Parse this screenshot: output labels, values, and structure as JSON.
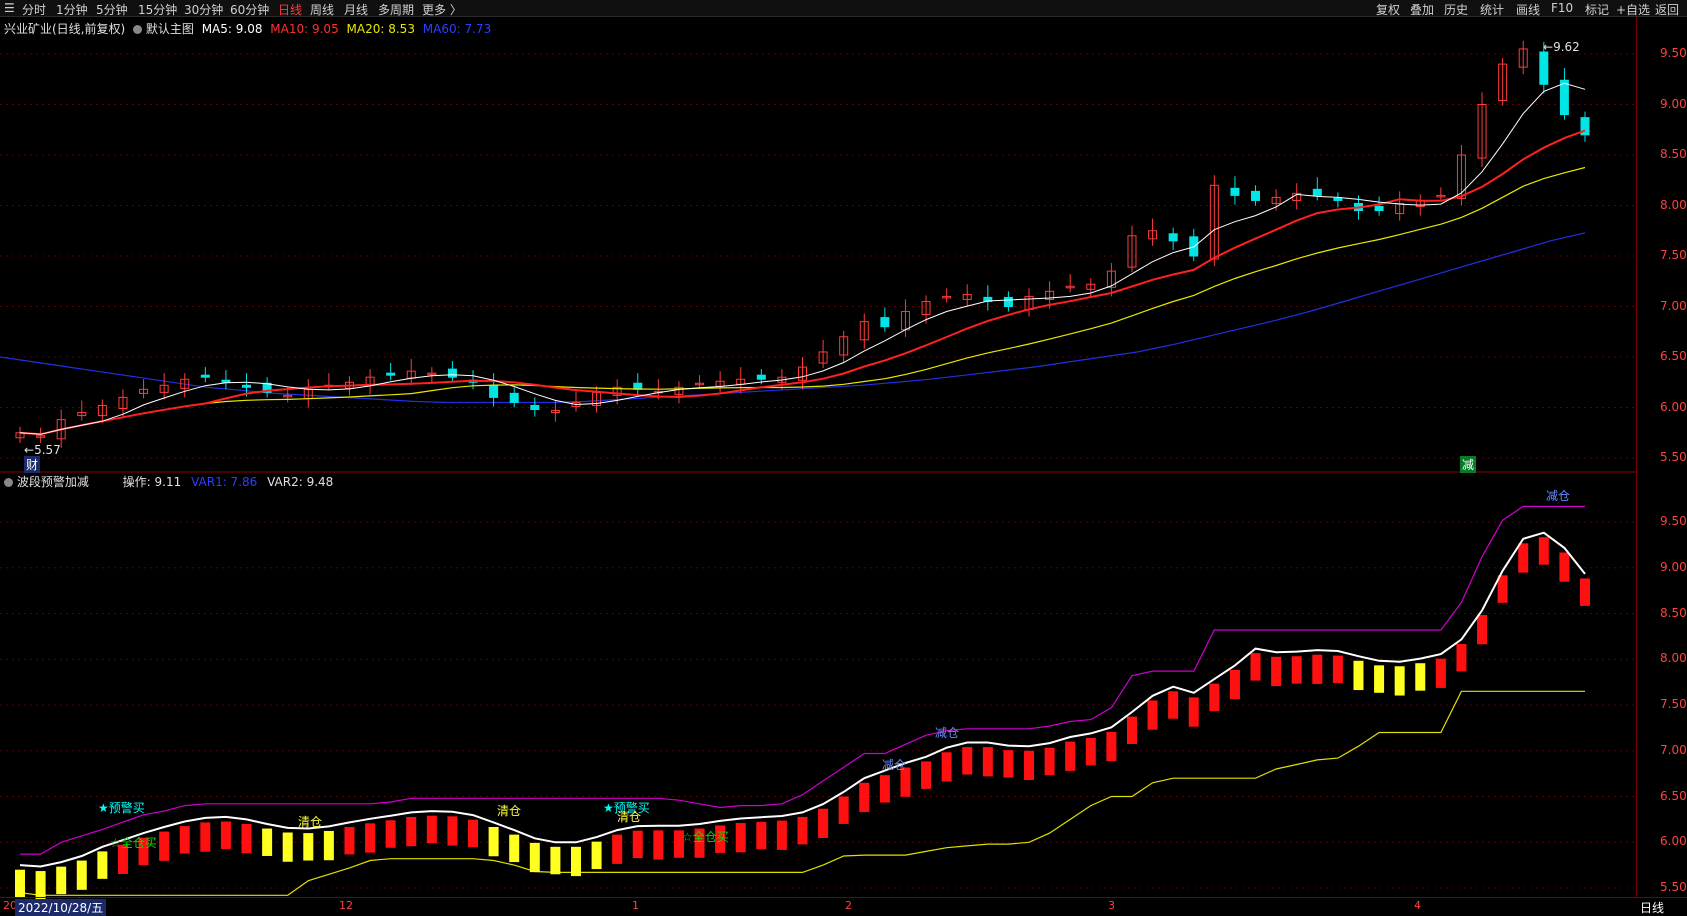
{
  "toolbar": {
    "period_tabs": [
      "分时",
      "1分钟",
      "5分钟",
      "15分钟",
      "30分钟",
      "60分钟",
      "日线",
      "周线",
      "月线",
      "多周期",
      "更多 〉"
    ],
    "active_tab": "日线",
    "right_buttons": [
      "复权",
      "叠加",
      "历史",
      "统计",
      "画线",
      "F10",
      "+自选",
      "返回"
    ]
  },
  "main_panel": {
    "stock_title": "兴业矿业(日线,前复权)",
    "template_label": "默认主图",
    "ma5": "MA5: 9.08",
    "ma10": "MA10: 9.05",
    "ma20": "MA20: 8.53",
    "ma60": "MA60: 7.73",
    "high_marker": "9.62",
    "low_marker": "5.57",
    "event_marker": "财",
    "reduce_marker": "减",
    "mark_label": "标记"
  },
  "indicator_panel": {
    "title": "波段预警加减",
    "op_value": "操作: 9.11",
    "var1": "VAR1: 7.86",
    "var2": "VAR2: 9.48",
    "signals": [
      "★预警买",
      "☆全仓买",
      "清仓",
      "清仓",
      "★预警买",
      "清仓",
      "☆全仓买",
      "减仓",
      "减仓",
      "减仓"
    ]
  },
  "y_axis_top": [
    "9.50",
    "9.00",
    "8.50",
    "8.00",
    "7.50",
    "7.00",
    "6.50",
    "6.00",
    "5.50"
  ],
  "y_axis_bottom": [
    "9.50",
    "9.00",
    "8.50",
    "8.00",
    "7.50",
    "7.00",
    "6.50",
    "6.00",
    "5.50"
  ],
  "x_axis": {
    "date_box": "2022/10/28/五",
    "first_label": "20",
    "months": [
      "12",
      "1",
      "2",
      "3",
      "4"
    ],
    "period_button": "日线"
  },
  "colors": {
    "up": "#ff3b3b",
    "down": "#00e5e5",
    "ma5": "#ffffff",
    "ma10": "#ff2020",
    "ma20": "#e8e800",
    "ma60": "#2030e0",
    "upper": "#d000d0",
    "lower": "#e0e000"
  },
  "chart_data": {
    "type": "candlestick",
    "ylim_top": [
      5.5,
      9.7
    ],
    "close": [
      5.75,
      5.72,
      5.88,
      5.95,
      6.02,
      6.1,
      6.18,
      6.22,
      6.28,
      6.3,
      6.25,
      6.2,
      6.15,
      6.12,
      6.18,
      6.22,
      6.25,
      6.3,
      6.32,
      6.36,
      6.34,
      6.3,
      6.25,
      6.1,
      6.05,
      5.98,
      5.97,
      6.05,
      6.15,
      6.2,
      6.18,
      6.16,
      6.2,
      6.24,
      6.26,
      6.28,
      6.28,
      6.3,
      6.4,
      6.55,
      6.7,
      6.85,
      6.8,
      6.95,
      7.05,
      7.1,
      7.12,
      7.05,
      7.0,
      7.1,
      7.15,
      7.2,
      7.22,
      7.35,
      7.7,
      7.75,
      7.65,
      7.5,
      8.2,
      8.1,
      8.05,
      8.08,
      8.12,
      8.1,
      8.05,
      7.95,
      7.95,
      8.02,
      8.05,
      8.1,
      8.5,
      9.0,
      9.4,
      9.55,
      9.2,
      8.9,
      8.7
    ],
    "ma60": [
      6.5,
      6.45,
      6.4,
      6.35,
      6.3,
      6.25,
      6.2,
      6.17,
      6.14,
      6.12,
      6.1,
      6.08,
      6.06,
      6.05,
      6.05,
      6.05,
      6.05,
      6.06,
      6.08,
      6.1,
      6.12,
      6.14,
      6.16,
      6.18,
      6.2,
      6.22,
      6.25,
      6.28,
      6.32,
      6.36,
      6.4,
      6.45,
      6.5,
      6.55,
      6.62,
      6.7,
      6.78,
      6.86,
      6.95,
      7.05,
      7.15,
      7.25,
      7.35,
      7.45,
      7.55,
      7.65,
      7.73
    ]
  }
}
